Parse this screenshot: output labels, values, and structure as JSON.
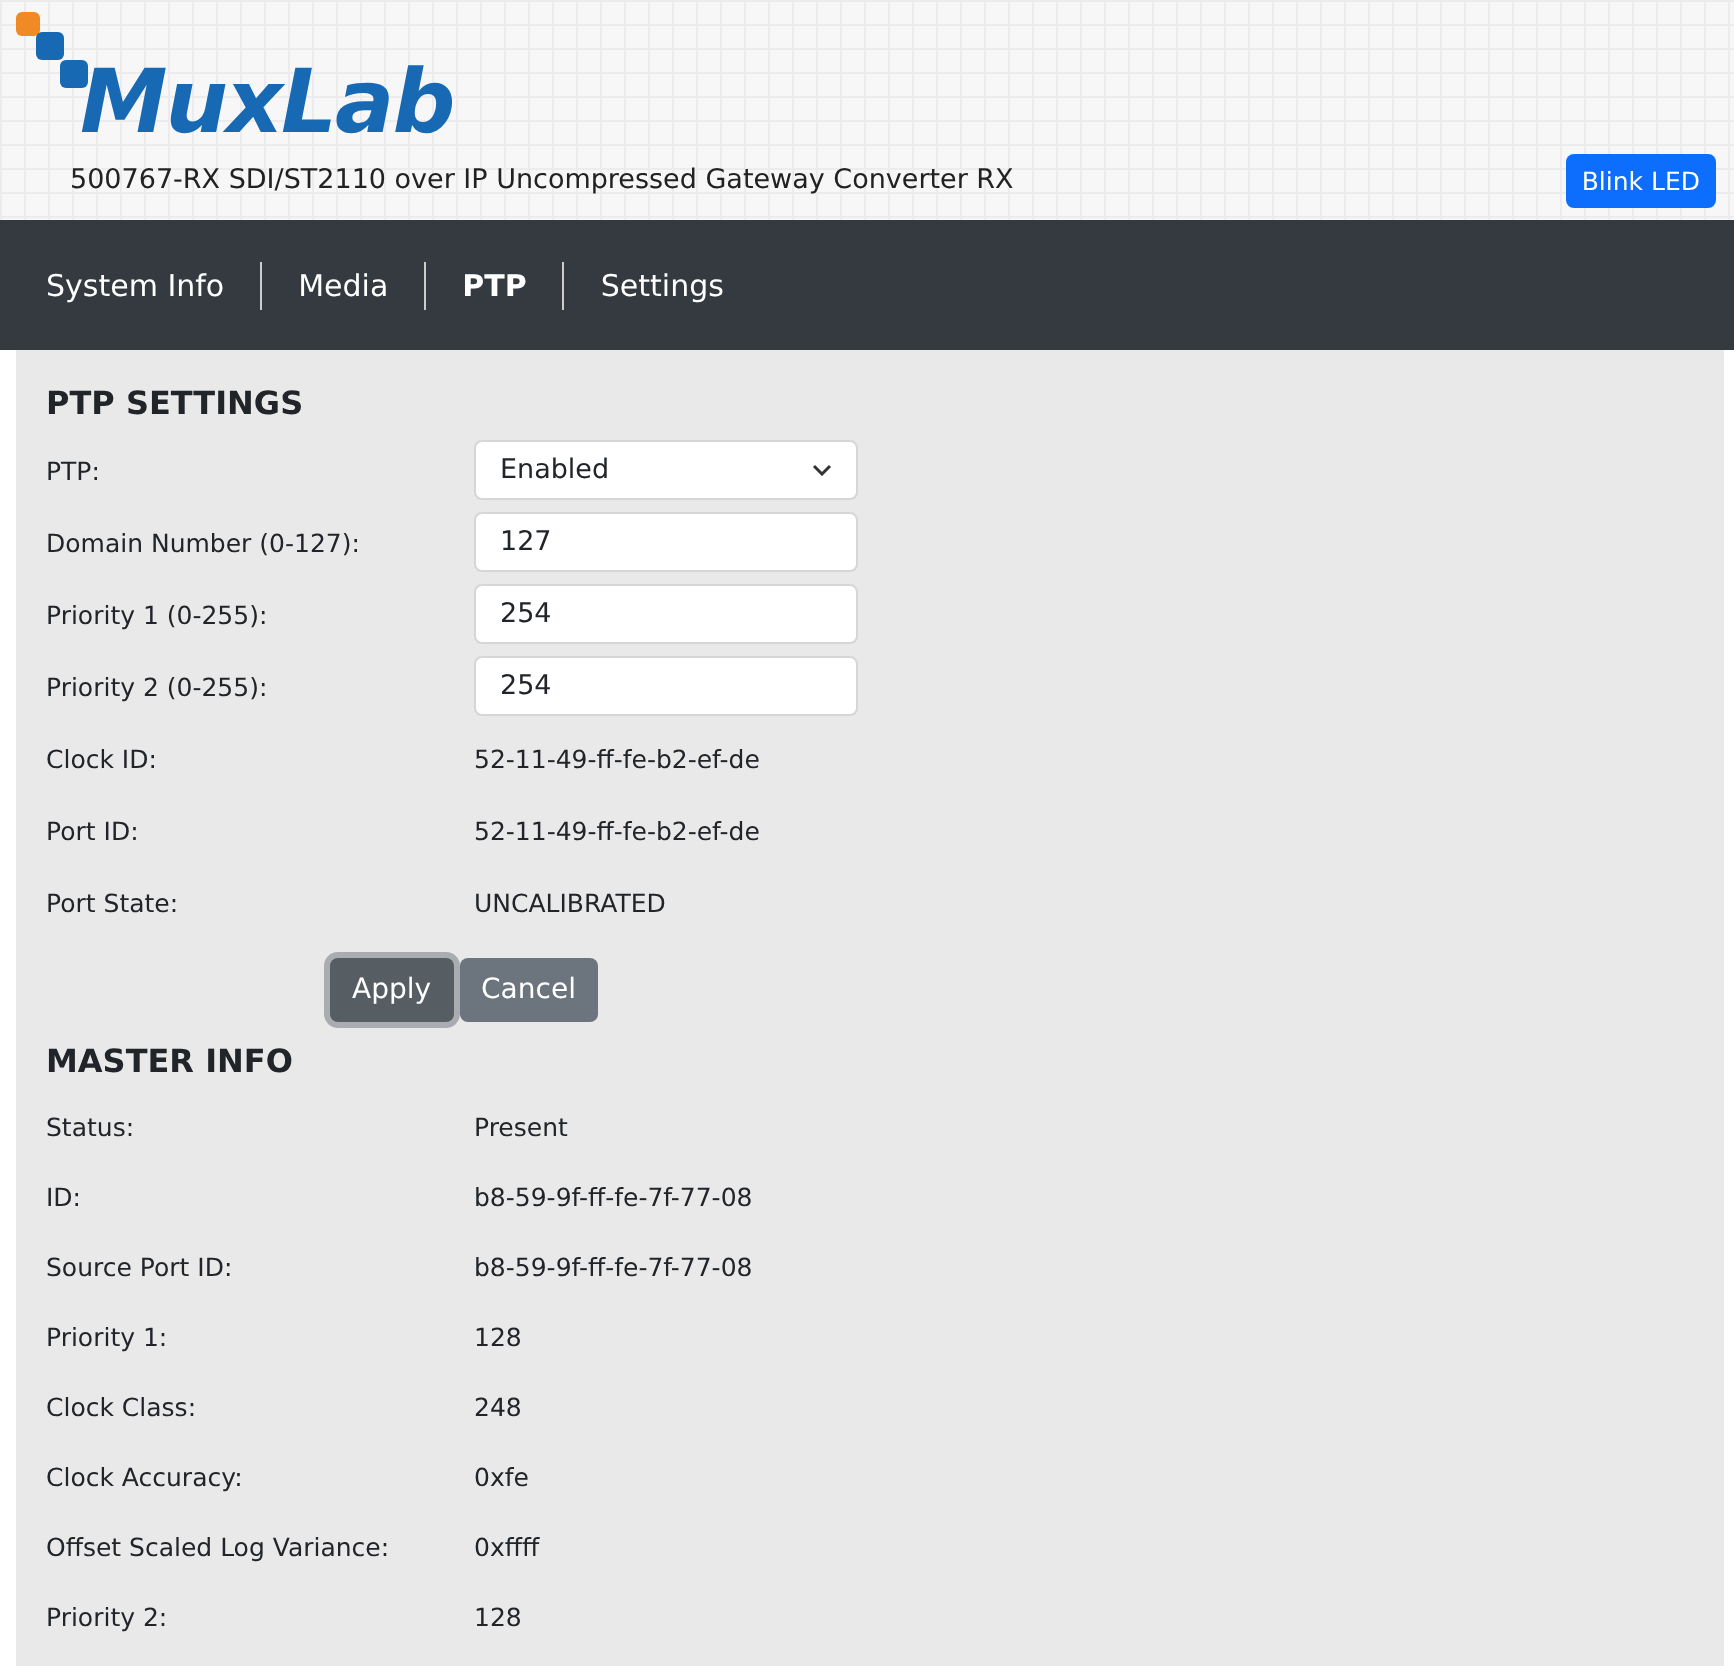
{
  "header": {
    "logo": "MuxLab",
    "product": "500767-RX SDI/ST2110 over IP Uncompressed Gateway Converter RX",
    "button": "Blink LED"
  },
  "nav": [
    {
      "label": "System Info",
      "selected": false
    },
    {
      "label": "Media",
      "selected": false
    },
    {
      "label": "PTP",
      "selected": true
    },
    {
      "label": "Settings",
      "selected": false
    }
  ],
  "ptp_settings": {
    "title": "PTP SETTINGS",
    "rows": [
      {
        "kind": "select",
        "label": "PTP:",
        "value": "Enabled"
      },
      {
        "kind": "input",
        "label": "Domain Number (0-127):",
        "value": "127"
      },
      {
        "kind": "input",
        "label": "Priority 1 (0-255):",
        "value": "254"
      },
      {
        "kind": "input",
        "label": "Priority 2 (0-255):",
        "value": "254"
      },
      {
        "kind": "text",
        "label": "Clock ID:",
        "value": "52-11-49-ff-fe-b2-ef-de"
      },
      {
        "kind": "text",
        "label": "Port ID:",
        "value": "52-11-49-ff-fe-b2-ef-de"
      },
      {
        "kind": "text",
        "label": "Port State:",
        "value": "UNCALIBRATED"
      }
    ],
    "buttons": [
      {
        "label": "Apply",
        "focused": true
      },
      {
        "label": "Cancel",
        "focused": false
      }
    ]
  },
  "master_info": {
    "title": "MASTER INFO",
    "rows": [
      {
        "label": "Status:",
        "value": "Present"
      },
      {
        "label": "ID:",
        "value": "b8-59-9f-ff-fe-7f-77-08"
      },
      {
        "label": "Source Port ID:",
        "value": "b8-59-9f-ff-fe-7f-77-08"
      },
      {
        "label": "Priority 1:",
        "value": "128"
      },
      {
        "label": "Clock Class:",
        "value": "248"
      },
      {
        "label": "Clock Accuracy:",
        "value": "0xfe"
      },
      {
        "label": "Offset Scaled Log Variance:",
        "value": "0xffff"
      },
      {
        "label": "Priority 2:",
        "value": "128"
      }
    ]
  }
}
